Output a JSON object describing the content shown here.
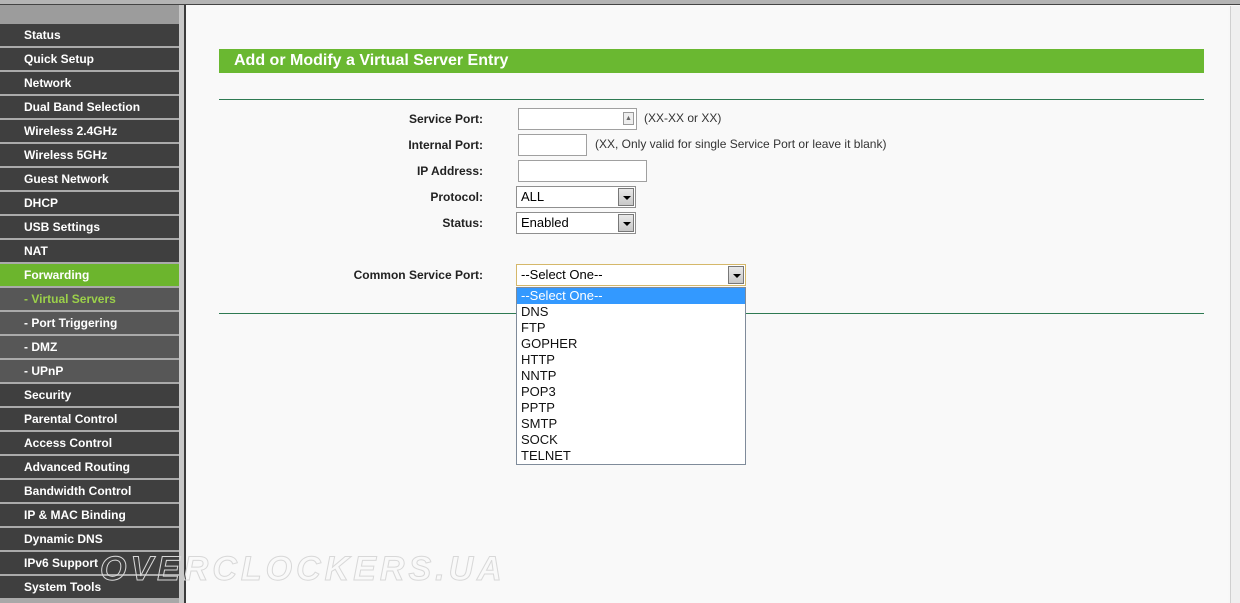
{
  "sidebar": {
    "items": [
      {
        "label": "Status",
        "type": "main"
      },
      {
        "label": "Quick Setup",
        "type": "main"
      },
      {
        "label": "Network",
        "type": "main"
      },
      {
        "label": "Dual Band Selection",
        "type": "main"
      },
      {
        "label": "Wireless 2.4GHz",
        "type": "main"
      },
      {
        "label": "Wireless 5GHz",
        "type": "main"
      },
      {
        "label": "Guest Network",
        "type": "main"
      },
      {
        "label": "DHCP",
        "type": "main"
      },
      {
        "label": "USB Settings",
        "type": "main"
      },
      {
        "label": "NAT",
        "type": "main"
      },
      {
        "label": "Forwarding",
        "type": "active"
      },
      {
        "label": "- Virtual Servers",
        "type": "current"
      },
      {
        "label": "- Port Triggering",
        "type": "sub"
      },
      {
        "label": "- DMZ",
        "type": "sub"
      },
      {
        "label": "- UPnP",
        "type": "sub"
      },
      {
        "label": "Security",
        "type": "main"
      },
      {
        "label": "Parental Control",
        "type": "main"
      },
      {
        "label": "Access Control",
        "type": "main"
      },
      {
        "label": "Advanced Routing",
        "type": "main"
      },
      {
        "label": "Bandwidth Control",
        "type": "main"
      },
      {
        "label": "IP & MAC Binding",
        "type": "main"
      },
      {
        "label": "Dynamic DNS",
        "type": "main"
      },
      {
        "label": "IPv6 Support",
        "type": "main"
      },
      {
        "label": "System Tools",
        "type": "main"
      }
    ]
  },
  "page": {
    "title": "Add or Modify a Virtual Server Entry",
    "accent_color": "#6ab831"
  },
  "form": {
    "service_port": {
      "label": "Service Port:",
      "value": "",
      "hint": "(XX-XX or XX)"
    },
    "internal_port": {
      "label": "Internal Port:",
      "value": "",
      "hint": "(XX, Only valid for single Service Port or leave it blank)"
    },
    "ip_address": {
      "label": "IP Address:",
      "value": ""
    },
    "protocol": {
      "label": "Protocol:",
      "value": "ALL"
    },
    "status": {
      "label": "Status:",
      "value": "Enabled"
    },
    "common_service_port": {
      "label": "Common Service Port:",
      "value": "--Select One--",
      "options": [
        "--Select One--",
        "DNS",
        "FTP",
        "GOPHER",
        "HTTP",
        "NNTP",
        "POP3",
        "PPTP",
        "SMTP",
        "SOCK",
        "TELNET"
      ],
      "highlighted_index": 0
    }
  },
  "watermark": "OVERCLOCKERS.UA"
}
